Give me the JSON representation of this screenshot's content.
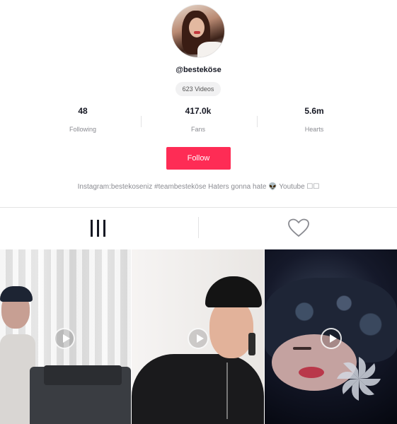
{
  "profile": {
    "username": "@besteköse",
    "videos_badge": "623 Videos",
    "bio": "Instagram:bestekoseniz #teambesteköse Haters gonna hate 👽 Youtube ☐☐"
  },
  "stats": {
    "following": {
      "value": "48",
      "label": "Following"
    },
    "fans": {
      "value": "417.0k",
      "label": "Fans"
    },
    "hearts": {
      "value": "5.6m",
      "label": "Hearts"
    }
  },
  "actions": {
    "follow_label": "Follow"
  },
  "colors": {
    "accent": "#fe2c55",
    "text": "#161823",
    "muted": "#8a8b91",
    "divider": "#e3e3e4"
  },
  "tabs": [
    {
      "name": "videos",
      "icon": "grid-icon",
      "active": true
    },
    {
      "name": "liked",
      "icon": "heart-outline-icon",
      "active": false
    }
  ],
  "videos": [
    {
      "icon": "play-icon"
    },
    {
      "icon": "play-icon"
    },
    {
      "icon": "play-icon"
    }
  ]
}
